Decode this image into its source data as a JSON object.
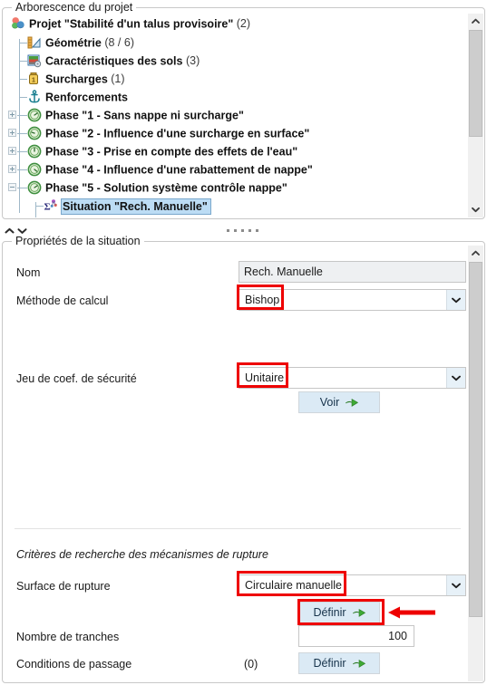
{
  "tree_panel": {
    "legend": "Arborescence du projet",
    "nodes": [
      {
        "label": "Projet \"Stabilité d'un talus provisoire\"",
        "count": "(2)",
        "icon": "project-icon",
        "level": 0,
        "expander": null,
        "selected": false
      },
      {
        "label": "Géométrie",
        "count": "(8 / 6)",
        "icon": "geometry-icon",
        "level": 1,
        "expander": null,
        "selected": false
      },
      {
        "label": "Caractéristiques des sols",
        "count": "(3)",
        "icon": "soil-properties-icon",
        "level": 1,
        "expander": null,
        "selected": false
      },
      {
        "label": "Surcharges",
        "count": "(1)",
        "icon": "surcharge-icon",
        "level": 1,
        "expander": null,
        "selected": false
      },
      {
        "label": "Renforcements",
        "count": "",
        "icon": "anchor-icon",
        "level": 1,
        "expander": null,
        "selected": false
      },
      {
        "label": "Phase \"1 - Sans nappe ni surcharge\"",
        "count": "",
        "icon": "phase-icon",
        "level": 1,
        "expander": "plus",
        "selected": false
      },
      {
        "label": "Phase \"2 - Influence d'une surcharge en surface\"",
        "count": "",
        "icon": "phase-icon",
        "level": 1,
        "expander": "plus",
        "selected": false
      },
      {
        "label": "Phase \"3 - Prise en compte des effets de l'eau\"",
        "count": "",
        "icon": "phase-icon",
        "level": 1,
        "expander": "plus",
        "selected": false
      },
      {
        "label": "Phase \"4 - Influence d'une rabattement de nappe\"",
        "count": "",
        "icon": "phase-icon",
        "level": 1,
        "expander": "plus",
        "selected": false
      },
      {
        "label": "Phase \"5 - Solution système contrôle nappe\"",
        "count": "",
        "icon": "phase-icon",
        "level": 1,
        "expander": "minus",
        "selected": false
      },
      {
        "label": "Situation \"Rech. Manuelle\"",
        "count": "",
        "icon": "situation-icon",
        "level": 2,
        "expander": null,
        "selected": true
      }
    ],
    "scrollbar": {
      "up_icon": "chevron-up-icon",
      "down_icon": "chevron-down-icon"
    }
  },
  "splitter": {
    "collapse_up_icon": "chevron-up-icon",
    "collapse_down_icon": "chevron-down-icon",
    "grip_icon": "grip-dots-icon"
  },
  "props_panel": {
    "legend": "Propriétés de la situation",
    "fields": {
      "nom_label": "Nom",
      "nom_value": "Rech. Manuelle",
      "methode_label": "Méthode de calcul",
      "methode_value": "Bishop",
      "jeu_label": "Jeu de coef. de sécurité",
      "jeu_value": "Unitaire",
      "voir_button": "Voir",
      "criteres_title": "Critères de recherche des mécanismes de rupture",
      "surface_label": "Surface de rupture",
      "surface_value": "Circulaire manuelle",
      "definir_surface_button": "Définir",
      "tranches_label": "Nombre de tranches",
      "tranches_value": "100",
      "passage_label": "Conditions de passage",
      "passage_count": "(0)",
      "definir_passage_button": "Définir"
    },
    "scrollbar": {
      "up_icon": "chevron-up-icon"
    }
  },
  "annotations": {
    "highlight_color": "#ee0000",
    "arrow_icon": "red-left-arrow-icon",
    "highlighted": [
      "methode_value",
      "jeu_value",
      "surface_value",
      "definir_surface_button"
    ]
  },
  "colors": {
    "selection_fill": "#bcdcf4",
    "selection_border": "#7aa8cc",
    "button_fill": "#dbeaf5",
    "readonly_field": "#eef0f2",
    "green_arrow": "#3eaa35",
    "annotation_red": "#ee0000"
  }
}
